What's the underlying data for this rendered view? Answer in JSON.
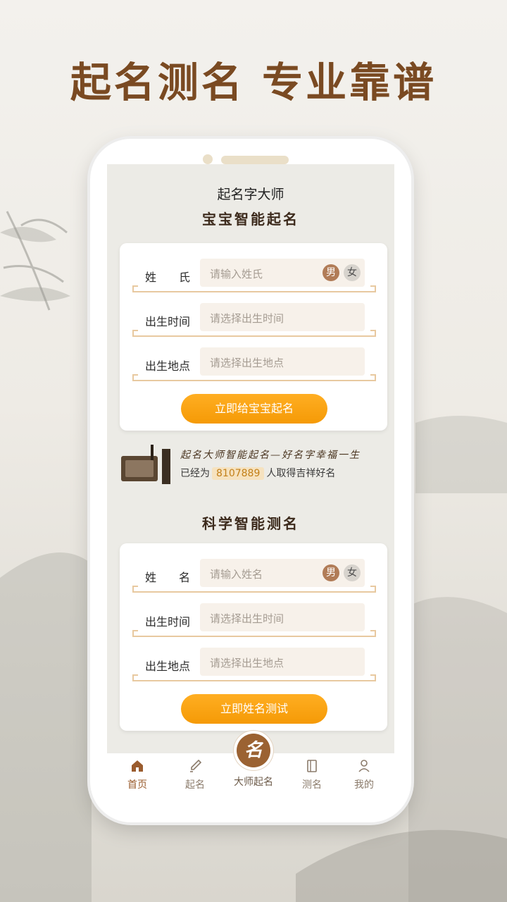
{
  "promo": {
    "headline": "起名测名 专业靠谱"
  },
  "app": {
    "title": "起名字大师"
  },
  "naming": {
    "section_title": "宝宝智能起名",
    "rows": [
      {
        "label": "姓　　氏",
        "placeholder": "请输入姓氏"
      },
      {
        "label": "出生时间",
        "placeholder": "请选择出生时间"
      },
      {
        "label": "出生地点",
        "placeholder": "请选择出生地点"
      }
    ],
    "gender_male": "男",
    "gender_female": "女",
    "cta": "立即给宝宝起名"
  },
  "banner": {
    "slogan": "起名大师智能起名—好名字幸福一生",
    "count_prefix": "已经为",
    "count": "8107889",
    "count_suffix": "人取得吉祥好名"
  },
  "testing": {
    "section_title": "科学智能测名",
    "rows": [
      {
        "label": "姓　　名",
        "placeholder": "请输入姓名"
      },
      {
        "label": "出生时间",
        "placeholder": "请选择出生时间"
      },
      {
        "label": "出生地点",
        "placeholder": "请选择出生地点"
      }
    ],
    "gender_male": "男",
    "gender_female": "女",
    "cta": "立即姓名测试"
  },
  "tabbar": {
    "home": "首页",
    "naming": "起名",
    "master_glyph": "名",
    "master": "大师起名",
    "testing": "测名",
    "mine": "我的"
  },
  "colors": {
    "accent": "#f59a06",
    "brown": "#9b6232",
    "title": "#7a4a22"
  }
}
